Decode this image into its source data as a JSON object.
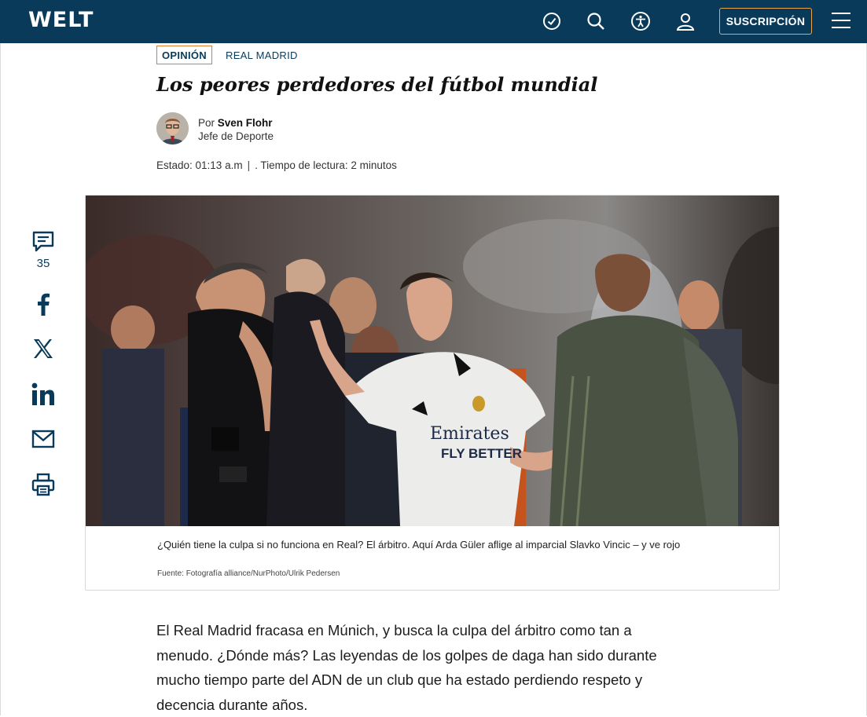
{
  "header": {
    "logo": "WELT",
    "subscribe_label": "SUSCRIPCIÓN",
    "icons": [
      "history-icon",
      "search-icon",
      "accessibility-icon",
      "user-icon",
      "menu-icon"
    ],
    "bg_color": "#0a3a5a",
    "accent_color": "#e9a64a"
  },
  "article": {
    "tag": "OPINIÓN",
    "section": "REAL MADRID",
    "headline": "Los peores perdedores del fútbol mundial",
    "by_prefix": "Por",
    "author": "Sven Flohr",
    "role": "Jefe de Deporte",
    "status": "Estado: 01:13 a.m",
    "separator": "|",
    "reading_time": ". Tiempo de lectura: 2 minutos"
  },
  "social": {
    "comment_count": "35",
    "icons": [
      "comment-icon",
      "facebook-icon",
      "x-icon",
      "linkedin-icon",
      "mail-icon",
      "print-icon"
    ]
  },
  "image": {
    "caption": "¿Quién tiene la culpa si no funciona en Real? El árbitro. Aquí Arda Güler aflige al imparcial Slavko Vincic – y ve rojo",
    "credit": "Fuente: Fotografía alliance/NurPhoto/Ulrik Pedersen",
    "shirt_text_1": "Emirates",
    "shirt_text_2": "FLY BETTER"
  },
  "body": {
    "paragraph_1": "El Real Madrid fracasa en Múnich, y busca la culpa del árbitro como tan a menudo. ¿Dónde más? Las leyendas de los golpes de daga han sido durante mucho tiempo parte del ADN de un club que ha estado perdiendo respeto y decencia durante años."
  }
}
